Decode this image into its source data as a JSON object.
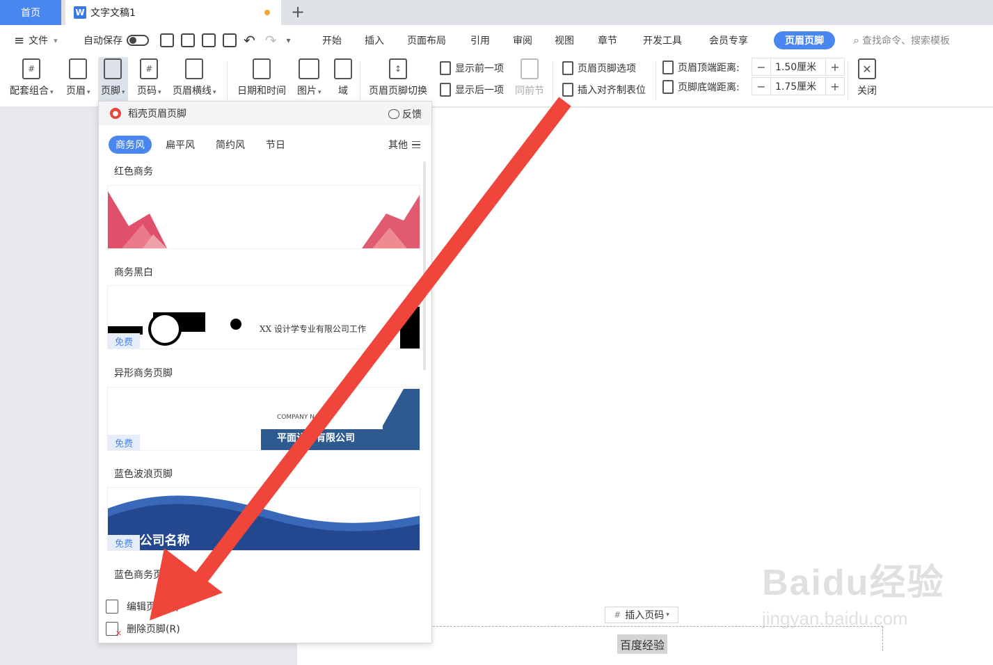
{
  "tabs": {
    "home": "首页",
    "doc": "文字文稿1"
  },
  "menu": {
    "file": "文件",
    "autosave": "自动保存",
    "items": [
      "开始",
      "插入",
      "页面布局",
      "引用",
      "审阅",
      "视图",
      "章节",
      "开发工具",
      "会员专享"
    ],
    "active": "页眉页脚",
    "search": "查找命令、搜索模板"
  },
  "ribbon": {
    "combo": "配套组合",
    "header": "页眉",
    "footer": "页脚",
    "pagenum": "页码",
    "header_line": "页眉横线",
    "datetime": "日期和时间",
    "picture": "图片",
    "field": "域",
    "switch": "页眉页脚切换",
    "prev": "显示前一项",
    "next": "显示后一项",
    "same_prev": "同前节",
    "options": "页眉页脚选项",
    "align_tab": "插入对齐制表位",
    "top_dist_label": "页眉顶端距离:",
    "top_dist_value": "1.50厘米",
    "bottom_dist_label": "页脚底端距离:",
    "bottom_dist_value": "1.75厘米",
    "close": "关闭"
  },
  "panel": {
    "title": "稻壳页眉页脚",
    "feedback": "反馈",
    "categories": [
      "商务风",
      "扁平风",
      "简约风",
      "节日"
    ],
    "more": "其他",
    "templates": [
      {
        "title": "红色商务"
      },
      {
        "title": "商务黑白",
        "badge": "免费",
        "text": "XX 设计学专业有限公司工作"
      },
      {
        "title": "异形商务页脚",
        "badge": "免费",
        "company": "COMPANY NAME",
        "name": "平面设计有限公司"
      },
      {
        "title": "蓝色波浪页脚",
        "badge": "免费",
        "name": "XXX公司名称"
      },
      {
        "title": "蓝色商务页脚"
      }
    ],
    "edit": "编辑页脚(E)",
    "delete": "删除页脚(R)"
  },
  "document": {
    "insert_pagenum": "插入页码",
    "footer_text": "百度经验"
  },
  "watermark": {
    "brand": "Baidu经验",
    "url": "jingyan.baidu.com"
  },
  "colors": {
    "accent": "#4a86f0",
    "arrow": "#f0453a"
  }
}
